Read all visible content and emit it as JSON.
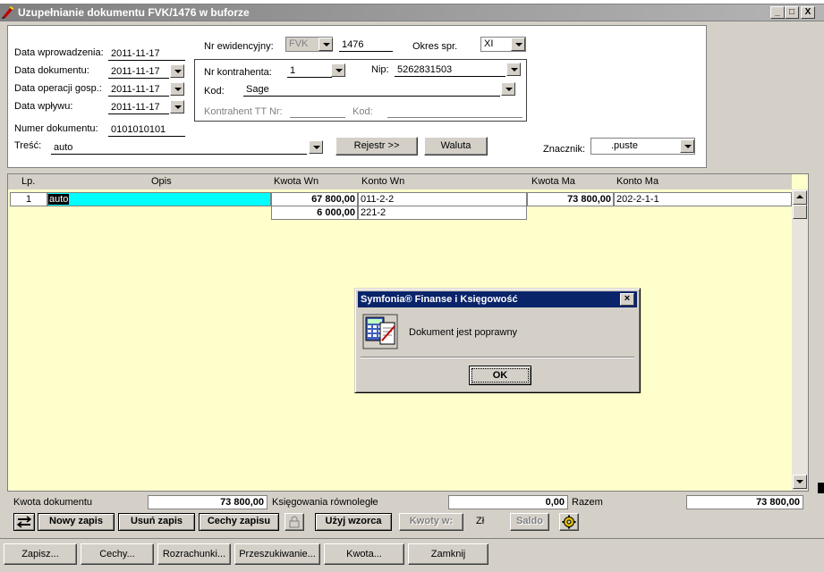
{
  "window": {
    "title": "Uzupełnianie dokumentu FVK/1476 w buforze",
    "min_label": "_",
    "max_label": "□",
    "close_label": "X"
  },
  "header": {
    "data_wprowadzenia_label": "Data wprowadzenia:",
    "data_wprowadzenia": "2011-11-17",
    "data_dokumentu_label": "Data dokumentu:",
    "data_dokumentu": "2011-11-17",
    "data_operacji_label": "Data operacji gosp.:",
    "data_operacji": "2011-11-17",
    "data_wplywu_label": "Data wpływu:",
    "data_wplywu": "2011-11-17",
    "numer_dokumentu_label": "Numer dokumentu:",
    "numer_dokumentu": "0101010101",
    "tresc_label": "Treść:",
    "tresc": "auto",
    "nr_ewidencyjny_label": "Nr ewidencyjny:",
    "nr_ewidencyjny_prefix": "FVK",
    "nr_ewidencyjny": "1476",
    "okres_label": "Okres spr.",
    "okres": "XI",
    "nr_kontrahenta_label": "Nr kontrahenta:",
    "nr_kontrahenta": "1",
    "nip_label": "Nip:",
    "nip": "5262831503",
    "kod_label": "Kod:",
    "kod": "Sage",
    "kontrahent_tt_label": "Kontrahent TT Nr:",
    "kod2_label": "Kod:",
    "rejestr_button": "Rejestr >>",
    "waluta_button": "Waluta",
    "znacznik_label": "Znacznik:",
    "znacznik": ".puste"
  },
  "grid": {
    "columns": [
      "Lp.",
      "Opis",
      "Kwota  Wn",
      "Konto  Wn",
      "Kwota Ma",
      "Konto Ma"
    ],
    "rows": [
      {
        "lp": "1",
        "opis": "auto",
        "kwota_wn": "67 800,00",
        "konto_wn": "011-2-2",
        "kwota_ma": "73 800,00",
        "konto_ma": "202-2-1-1"
      },
      {
        "lp": "",
        "opis": "",
        "kwota_wn": "6 000,00",
        "konto_wn": "221-2",
        "kwota_ma": "",
        "konto_ma": ""
      }
    ]
  },
  "totals": {
    "kwota_dokumentu_label": "Kwota dokumentu",
    "kwota_dokumentu": "73 800,00",
    "ksiegowania_label": "Księgowania równoległe",
    "ksiegowania": "0,00",
    "razem_label": "Razem",
    "razem": "73 800,00"
  },
  "toolbar": {
    "nowy_zapis": "Nowy zapis",
    "usun_zapis": "Usuń zapis",
    "cechy_zapisu": "Cechy zapisu",
    "uzyj_wzorca": "Użyj wzorca",
    "kwoty_w": "Kwoty w:",
    "currency": "Zł",
    "saldo": "Saldo"
  },
  "bottom_buttons": {
    "zapisz": "Zapisz...",
    "cechy": "Cechy...",
    "rozrachunki": "Rozrachunki...",
    "przeszukiwanie": "Przeszukiwanie...",
    "kwota": "Kwota...",
    "zamknij": "Zamknij"
  },
  "dialog": {
    "title": "Symfonia® Finanse i Księgowość",
    "message": "Dokument jest poprawny",
    "ok": "OK",
    "close_label": "×"
  },
  "colors": {
    "grid_bg": "#ffffcc",
    "selected_cell": "#00ffff",
    "dialog_title_bg": "#0a246a"
  }
}
